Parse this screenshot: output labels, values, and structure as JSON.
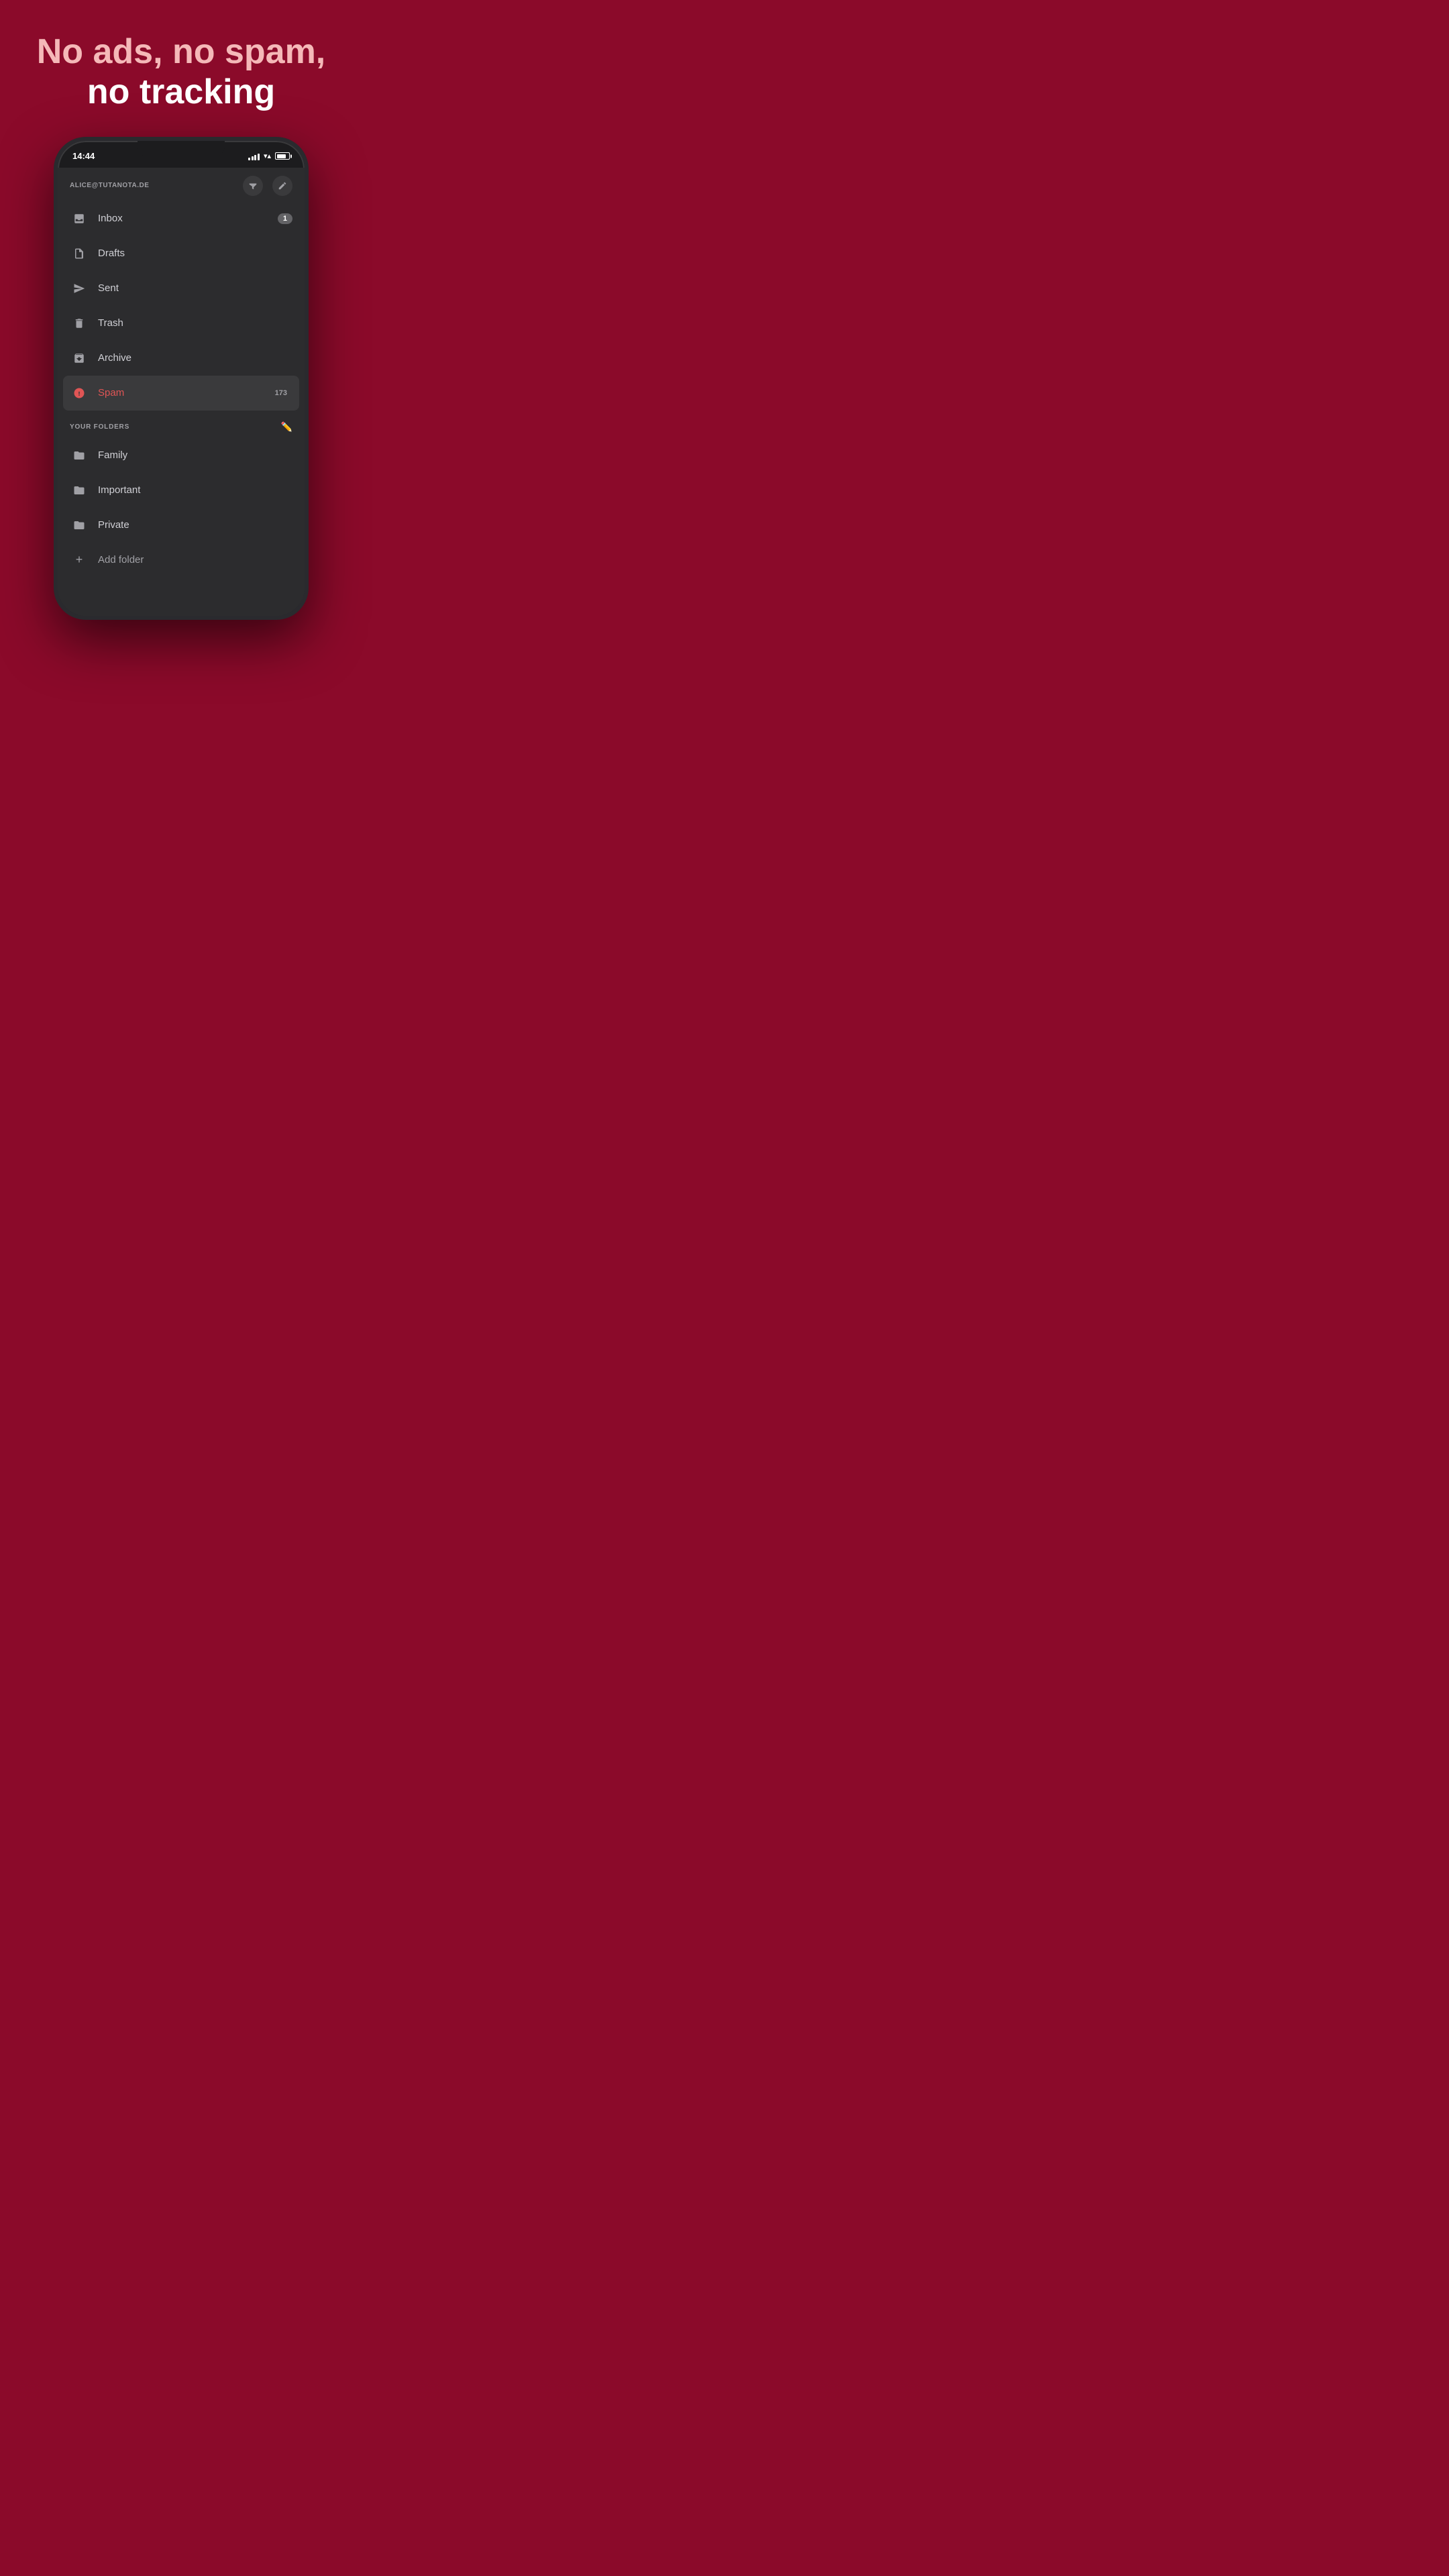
{
  "headline": {
    "line1": "No ads, no spam,",
    "line2": "no tracking"
  },
  "status_bar": {
    "time": "14:44"
  },
  "email": "ALICE@TUTANOTA.DE",
  "nav_items": [
    {
      "id": "inbox",
      "label": "Inbox",
      "badge": "1",
      "active": false
    },
    {
      "id": "drafts",
      "label": "Drafts",
      "badge": "",
      "active": false
    },
    {
      "id": "sent",
      "label": "Sent",
      "badge": "",
      "active": false
    },
    {
      "id": "trash",
      "label": "Trash",
      "badge": "",
      "active": false
    },
    {
      "id": "archive",
      "label": "Archive",
      "badge": "",
      "active": false
    },
    {
      "id": "spam",
      "label": "Spam",
      "badge": "173",
      "active": true
    }
  ],
  "folders_section": {
    "title": "YOUR FOLDERS"
  },
  "folders": [
    {
      "id": "family",
      "label": "Family"
    },
    {
      "id": "important",
      "label": "Important"
    },
    {
      "id": "private",
      "label": "Private"
    }
  ],
  "add_folder_label": "Add folder"
}
